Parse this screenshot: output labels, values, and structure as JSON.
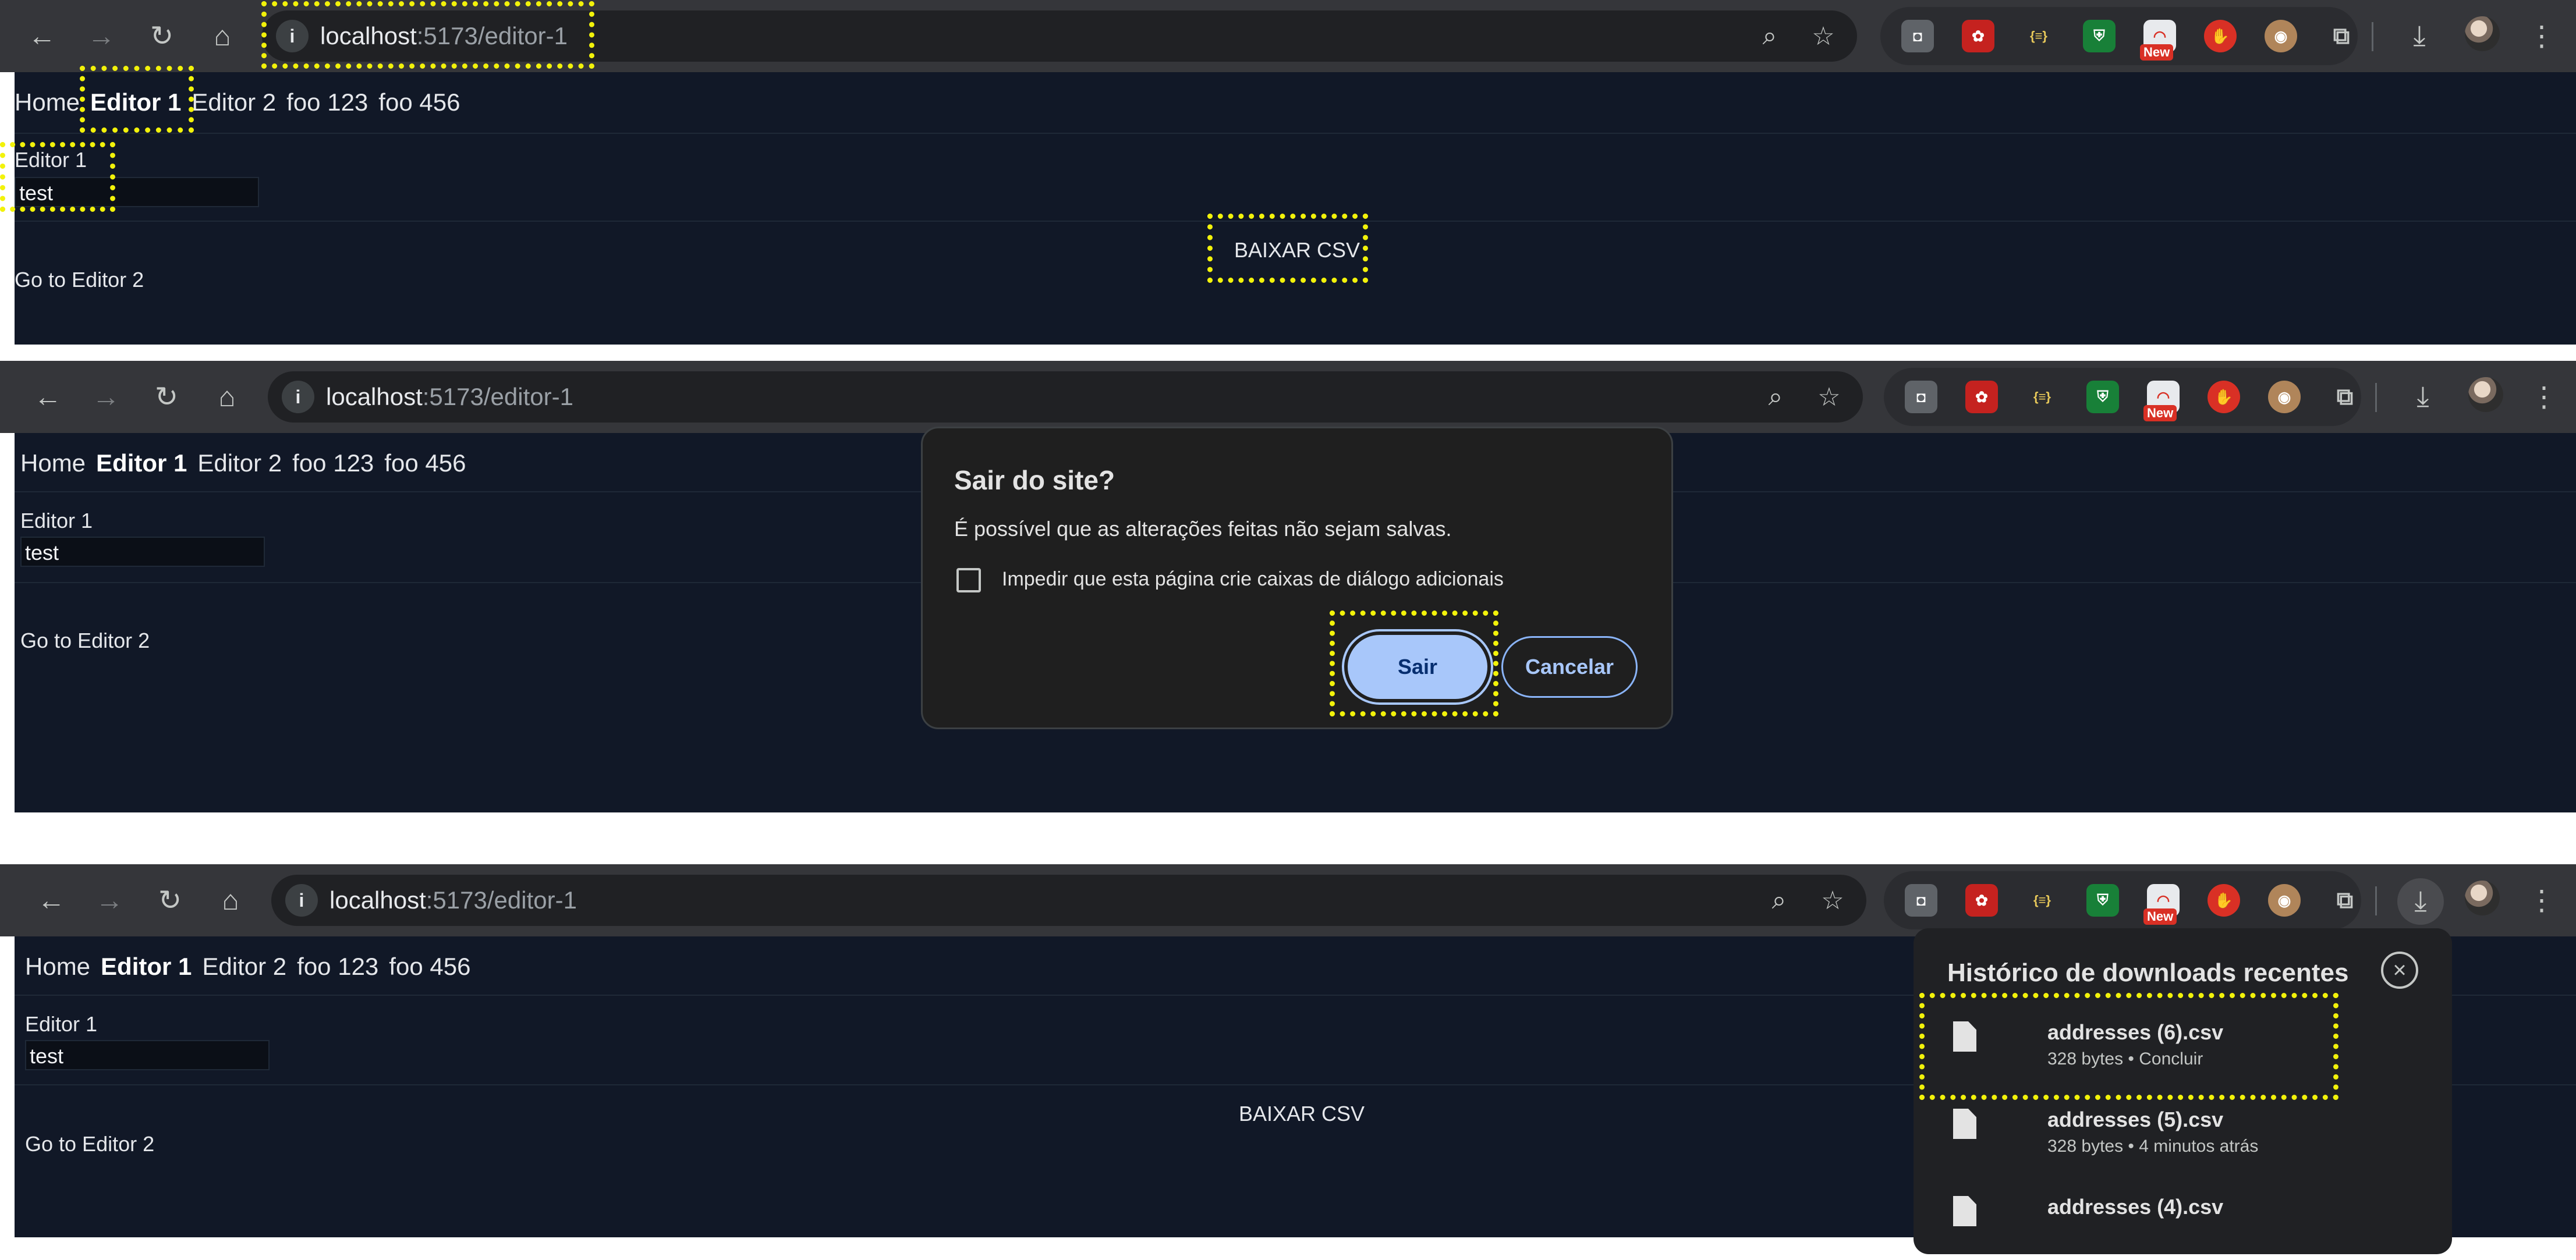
{
  "browser": {
    "url_host": "localhost",
    "url_path": ":5173/editor-1",
    "ext_new_badge": "New",
    "ext_brackets_label": "{≡}"
  },
  "app": {
    "nav": [
      "Home",
      "Editor 1",
      "Editor 2",
      "foo 123",
      "foo 456"
    ],
    "editor_label": "Editor 1",
    "editor_value": "test",
    "csv_button": "BAIXAR CSV",
    "goto_link": "Go to Editor 2"
  },
  "dialog": {
    "title": "Sair do site?",
    "message": "É possível que as alterações feitas não sejam salvas.",
    "checkbox_label": "Impedir que esta página crie caixas de diálogo adicionais",
    "confirm": "Sair",
    "cancel": "Cancelar"
  },
  "downloads": {
    "title": "Histórico de downloads recentes",
    "items": [
      {
        "name": "addresses (6).csv",
        "meta": "328 bytes • Concluir"
      },
      {
        "name": "addresses (5).csv",
        "meta": "328 bytes • 4 minutos atrás"
      },
      {
        "name": "addresses (4).csv",
        "meta": ""
      }
    ]
  },
  "colors": {
    "highlight": "#f2f20a",
    "page_bg": "#111827",
    "chrome_bg": "#35363a",
    "primary_button": "#a8c7fa"
  }
}
